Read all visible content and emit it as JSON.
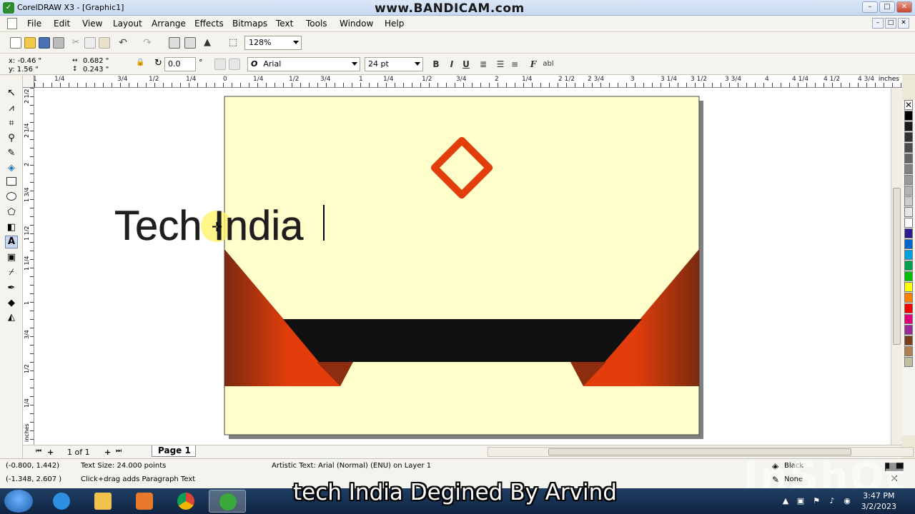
{
  "window": {
    "title": "CorelDRAW X3 - [Graphic1]",
    "watermark": "www.BANDICAM.com",
    "min_glyph": "–",
    "max_glyph": "□",
    "close_glyph": "✕"
  },
  "menu": {
    "items": [
      "File",
      "Edit",
      "View",
      "Layout",
      "Arrange",
      "Effects",
      "Bitmaps",
      "Text",
      "Tools",
      "Window",
      "Help"
    ]
  },
  "toolbar": {
    "zoom": "128%"
  },
  "propbar": {
    "x": "x: -0.46 \"",
    "y": "y: 1.56 \"",
    "width": "0.682 \"",
    "height": "0.243 \"",
    "rotation": "0.0",
    "degree_symbol": "°",
    "font_glyph": "O",
    "font_name": "Arial",
    "font_size": "24 pt",
    "bold": "B",
    "italic": "I",
    "underline": "U",
    "char_format": "F",
    "edit_text": "abl"
  },
  "ruler": {
    "h_labels": [
      "1",
      "1/4",
      "3/4",
      "1/2",
      "1/4",
      "0",
      "1/4",
      "1/2",
      "3/4",
      "1",
      "1/4",
      "1/2",
      "3/4",
      "2",
      "1/4",
      "2 1/2",
      "2 3/4",
      "3",
      "3 1/4",
      "3 1/2",
      "3 3/4",
      "4",
      "4 1/4",
      "4 1/2",
      "4 3/4",
      "inches"
    ],
    "v_labels": [
      "2 1/2",
      "2 1/4",
      "2",
      "1 3/4",
      "1 1/2",
      "1 1/4",
      "1",
      "3/4",
      "1/2",
      "1/4",
      "inches"
    ]
  },
  "canvas": {
    "text_object": "Tech India",
    "colors": {
      "page_bg": "#ffffcc",
      "accent_orange": "#e23d0a",
      "dark_band": "#111111",
      "shadow": "#808080"
    }
  },
  "palette": {
    "swatches": [
      "#000000",
      "#1a1a1a",
      "#333333",
      "#4d4d4d",
      "#666666",
      "#808080",
      "#999999",
      "#b3b3b3",
      "#cccccc",
      "#e6e6e6",
      "#ffffff",
      "#2b1d8f",
      "#0066cc",
      "#00a0e0",
      "#00a050",
      "#00c000",
      "#ffff00",
      "#ff8000",
      "#ff0000",
      "#e0007a",
      "#9a2a9a",
      "#7a3f1e",
      "#b08050",
      "#c0c0a0"
    ]
  },
  "pagebar": {
    "counter": "1 of 1",
    "page_tab": "Page 1"
  },
  "status": {
    "coords1": "(-0.800, 1.442)",
    "text_size": "Text Size: 24.000 points",
    "coords2": "(-1.348, 2.607 )",
    "hint": "Click+drag adds Paragraph Text",
    "object_info": "Artistic Text: Arial (Normal) (ENU) on Layer 1",
    "fill": "Black",
    "outline": "None"
  },
  "overlay": {
    "subtitle": "tech India Degined By Arvind",
    "faded_watermark": "InShOt"
  },
  "taskbar": {
    "time": "3:47 PM",
    "date": "3/2/2023"
  }
}
